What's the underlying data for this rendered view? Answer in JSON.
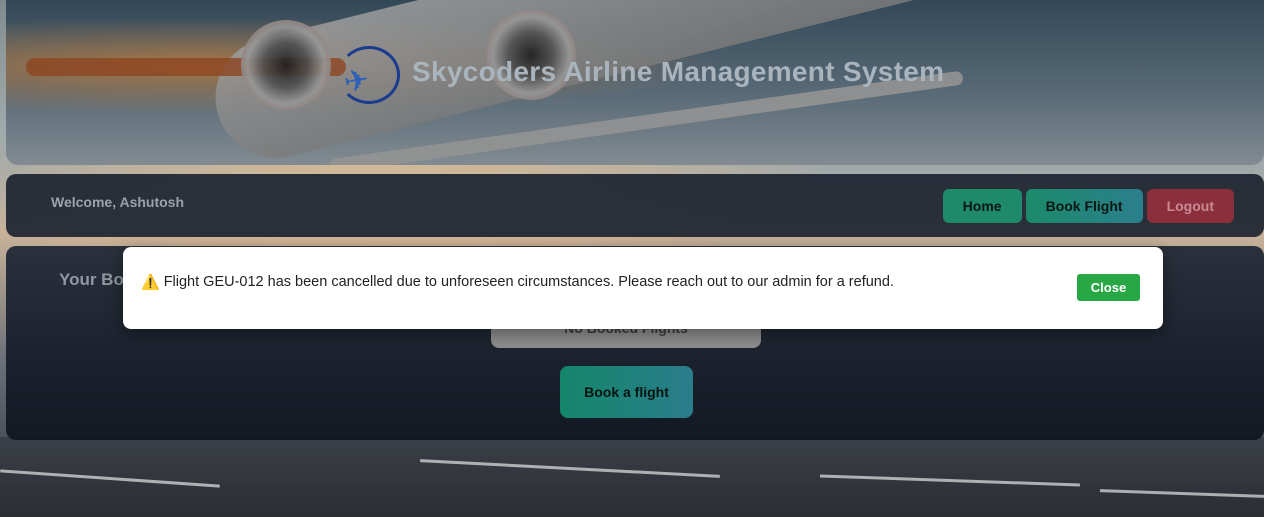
{
  "header": {
    "title": "Skycoders Airline Management System",
    "logo_icon": "airplane-globe-logo"
  },
  "nav": {
    "welcome": "Welcome, Ashutosh",
    "home_label": "Home",
    "book_flight_label": "Book Flight",
    "logout_label": "Logout"
  },
  "bookings": {
    "title": "Your Bo",
    "empty_label": "No Booked Flights",
    "book_button_label": "Book a flight"
  },
  "alert": {
    "icon": "warning-icon",
    "message": "Flight GEU-012 has been cancelled due to unforeseen circumstances. Please reach out to our admin for a refund.",
    "close_label": "Close"
  },
  "colors": {
    "primary_button": "#1f8a6a",
    "logout_button": "#8a2f3b",
    "close_button": "#28a745"
  }
}
